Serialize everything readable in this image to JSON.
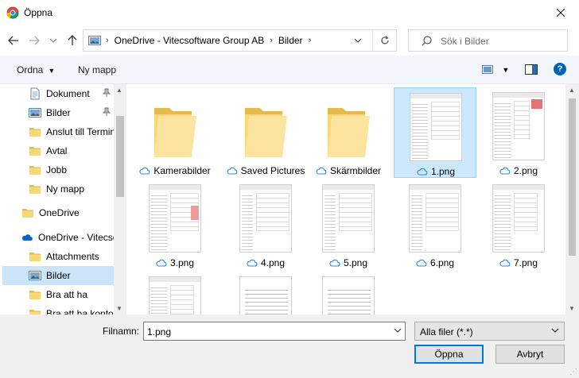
{
  "window": {
    "title": "Öppna"
  },
  "address": {
    "crumbs": [
      "OneDrive - Vitecsoftware Group AB",
      "Bilder"
    ]
  },
  "search": {
    "placeholder": "Sök i Bilder"
  },
  "commands": {
    "organize": "Ordna",
    "new_folder": "Ny mapp"
  },
  "sidebar": {
    "items": [
      {
        "label": "Dokument",
        "icon": "documents-icon",
        "pinned": true
      },
      {
        "label": "Bilder",
        "icon": "pictures-icon",
        "pinned": true
      },
      {
        "label": "Anslut till Termin",
        "icon": "folder-icon"
      },
      {
        "label": "Avtal",
        "icon": "folder-icon"
      },
      {
        "label": "Jobb",
        "icon": "folder-icon"
      },
      {
        "label": "Ny mapp",
        "icon": "folder-icon"
      },
      {
        "label": "OneDrive",
        "icon": "folder-icon"
      },
      {
        "label": "OneDrive - Vitecsc",
        "icon": "onedrive-cloud-icon"
      },
      {
        "label": "Attachments",
        "icon": "folder-icon"
      },
      {
        "label": "Bilder",
        "icon": "pictures-icon",
        "selected": true
      },
      {
        "label": "Bra att ha",
        "icon": "folder-icon"
      },
      {
        "label": "Bra att ha konto",
        "icon": "folder-icon"
      }
    ]
  },
  "files": [
    {
      "name": "Kamerabilder",
      "kind": "folder"
    },
    {
      "name": "Saved Pictures",
      "kind": "folder"
    },
    {
      "name": "Skärmbilder",
      "kind": "folder"
    },
    {
      "name": "1.png",
      "kind": "image",
      "selected": true
    },
    {
      "name": "2.png",
      "kind": "image"
    },
    {
      "name": "3.png",
      "kind": "image"
    },
    {
      "name": "4.png",
      "kind": "image"
    },
    {
      "name": "5.png",
      "kind": "image"
    },
    {
      "name": "6.png",
      "kind": "image"
    },
    {
      "name": "7.png",
      "kind": "image"
    },
    {
      "name": "",
      "kind": "image"
    },
    {
      "name": "",
      "kind": "doc"
    },
    {
      "name": "",
      "kind": "doc"
    }
  ],
  "footer": {
    "filename_label": "Filnamn:",
    "filename_value": "1.png",
    "filetype": "Alla filer (*.*)",
    "open": "Öppna",
    "cancel": "Avbryt"
  },
  "colors": {
    "accent": "#0078d7",
    "selection": "#cce8ff",
    "folder": "#f8d775",
    "cloud": "#2b88d8"
  }
}
